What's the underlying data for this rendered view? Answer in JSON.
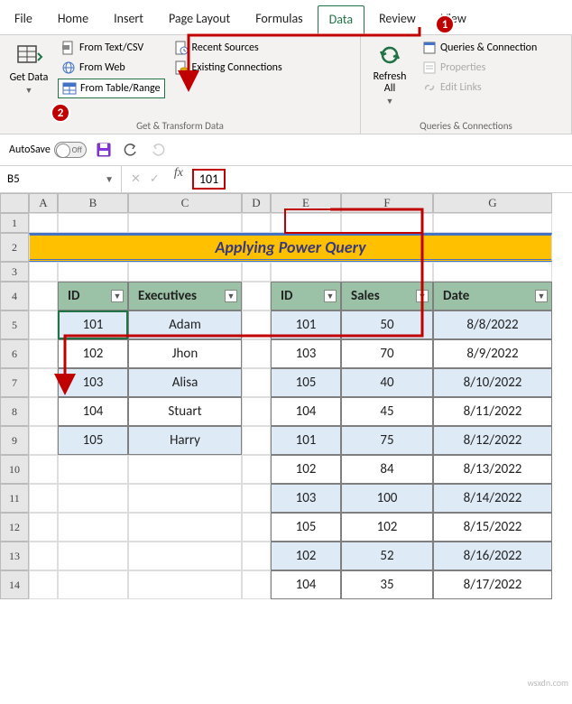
{
  "tabs": {
    "file": "File",
    "home": "Home",
    "insert": "Insert",
    "page_layout": "Page Layout",
    "formulas": "Formulas",
    "data": "Data",
    "review": "Review",
    "view": "View"
  },
  "active_tab": "Data",
  "ribbon": {
    "group1": {
      "get_data": "Get Data",
      "from_text_csv": "From Text/CSV",
      "from_web": "From Web",
      "from_table_range": "From Table/Range",
      "recent_sources": "Recent Sources",
      "existing_connections": "Existing Connections",
      "label": "Get & Transform Data"
    },
    "group2": {
      "refresh_all": "Refresh All",
      "queries_connections": "Queries & Connection",
      "properties": "Properties",
      "edit_links": "Edit Links",
      "label": "Queries & Connections"
    }
  },
  "badges": {
    "one": "1",
    "two": "2"
  },
  "qa": {
    "autosave": "AutoSave",
    "autosave_state": "Off"
  },
  "formula_bar": {
    "name_box": "B5",
    "value": "101"
  },
  "columns": [
    "A",
    "B",
    "C",
    "D",
    "E",
    "F",
    "G"
  ],
  "rows": [
    "1",
    "2",
    "3",
    "4",
    "5",
    "6",
    "7",
    "8",
    "9",
    "10",
    "11",
    "12",
    "13",
    "14"
  ],
  "title": "Applying Power Query",
  "table1": {
    "headers": {
      "id": "ID",
      "exec": "Executives"
    },
    "data": [
      {
        "id": "101",
        "exec": "Adam"
      },
      {
        "id": "102",
        "exec": "Jhon"
      },
      {
        "id": "103",
        "exec": "Alisa"
      },
      {
        "id": "104",
        "exec": "Stuart"
      },
      {
        "id": "105",
        "exec": "Harry"
      }
    ]
  },
  "table2": {
    "headers": {
      "id": "ID",
      "sales": "Sales",
      "date": "Date"
    },
    "data": [
      {
        "id": "101",
        "sales": "50",
        "date": "8/8/2022"
      },
      {
        "id": "103",
        "sales": "70",
        "date": "8/9/2022"
      },
      {
        "id": "105",
        "sales": "40",
        "date": "8/10/2022"
      },
      {
        "id": "104",
        "sales": "45",
        "date": "8/11/2022"
      },
      {
        "id": "101",
        "sales": "75",
        "date": "8/12/2022"
      },
      {
        "id": "102",
        "sales": "84",
        "date": "8/13/2022"
      },
      {
        "id": "103",
        "sales": "100",
        "date": "8/14/2022"
      },
      {
        "id": "105",
        "sales": "102",
        "date": "8/15/2022"
      },
      {
        "id": "102",
        "sales": "52",
        "date": "8/16/2022"
      },
      {
        "id": "104",
        "sales": "35",
        "date": "8/17/2022"
      }
    ]
  },
  "watermark": "wsxdn.com"
}
